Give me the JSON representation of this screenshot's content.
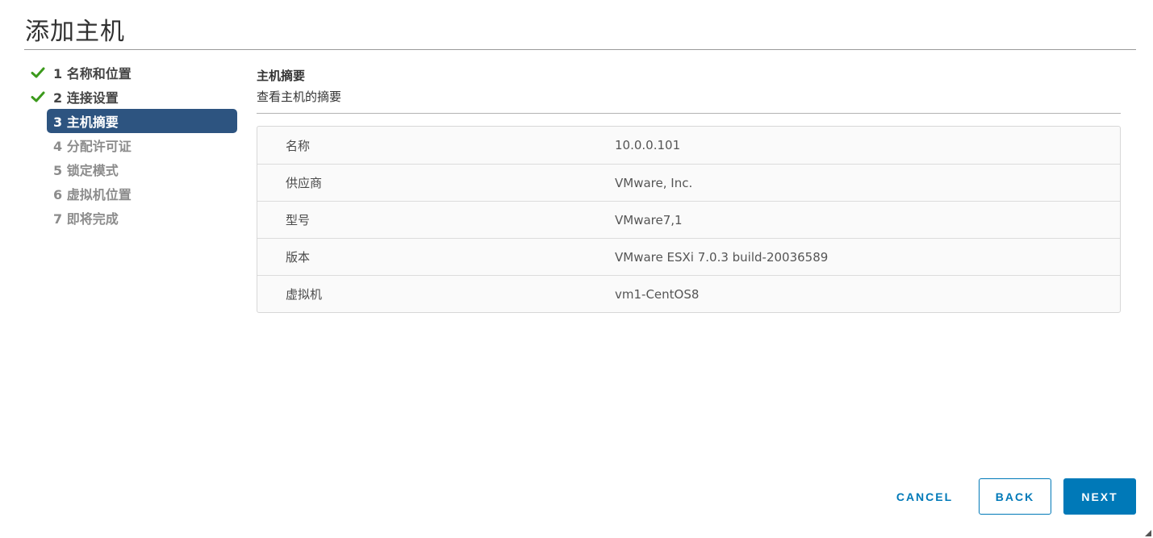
{
  "dialog": {
    "title": "添加主机"
  },
  "steps": [
    {
      "label": "1 名称和位置",
      "state": "done"
    },
    {
      "label": "2 连接设置",
      "state": "done"
    },
    {
      "label": "3 主机摘要",
      "state": "current"
    },
    {
      "label": "4 分配许可证",
      "state": "disabled"
    },
    {
      "label": "5 锁定模式",
      "state": "disabled"
    },
    {
      "label": "6 虚拟机位置",
      "state": "disabled"
    },
    {
      "label": "7 即将完成",
      "state": "disabled"
    }
  ],
  "content": {
    "title": "主机摘要",
    "subtitle": "查看主机的摘要"
  },
  "summary": [
    {
      "key": "名称",
      "value": "10.0.0.101"
    },
    {
      "key": "供应商",
      "value": "VMware, Inc."
    },
    {
      "key": "型号",
      "value": "VMware7,1"
    },
    {
      "key": "版本",
      "value": "VMware ESXi 7.0.3 build-20036589"
    },
    {
      "key": "虚拟机",
      "value": "vm1-CentOS8"
    }
  ],
  "footer": {
    "cancel_label": "CANCEL",
    "back_label": "BACK",
    "next_label": "NEXT"
  },
  "colors": {
    "accent": "#0079b8",
    "current_step_bg": "#2d5480",
    "check": "#3c9a1c"
  },
  "icons": {
    "done_step": "check-icon",
    "corner": "resize-grip-icon"
  }
}
